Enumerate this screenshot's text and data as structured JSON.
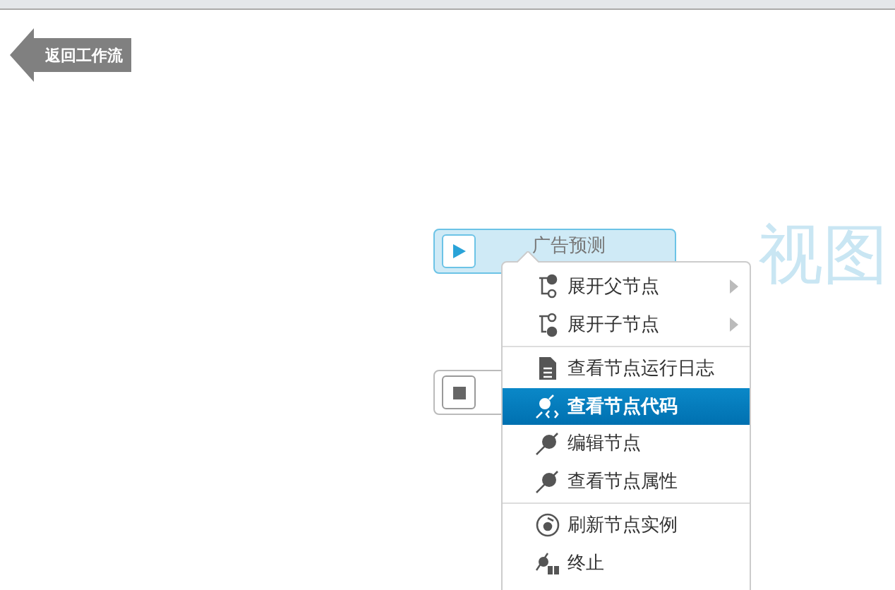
{
  "back_button": {
    "label": "返回工作流"
  },
  "view_label": "视图",
  "nodes": [
    {
      "title": "广告预测",
      "kind": "running",
      "selected": true
    },
    {
      "kind": "stopped",
      "selected": false
    }
  ],
  "context_menu": {
    "groups": [
      [
        {
          "label": "展开父节点",
          "submenu": true,
          "selected": false
        },
        {
          "label": "展开子节点",
          "submenu": true,
          "selected": false
        }
      ],
      [
        {
          "label": "查看节点运行日志",
          "submenu": false,
          "selected": false
        },
        {
          "label": "查看节点代码",
          "submenu": false,
          "selected": true
        },
        {
          "label": "编辑节点",
          "submenu": false,
          "selected": false
        },
        {
          "label": "查看节点属性",
          "submenu": false,
          "selected": false
        }
      ],
      [
        {
          "label": "刷新节点实例",
          "submenu": false,
          "selected": false
        },
        {
          "label": "终止",
          "submenu": false,
          "selected": false
        }
      ]
    ]
  }
}
